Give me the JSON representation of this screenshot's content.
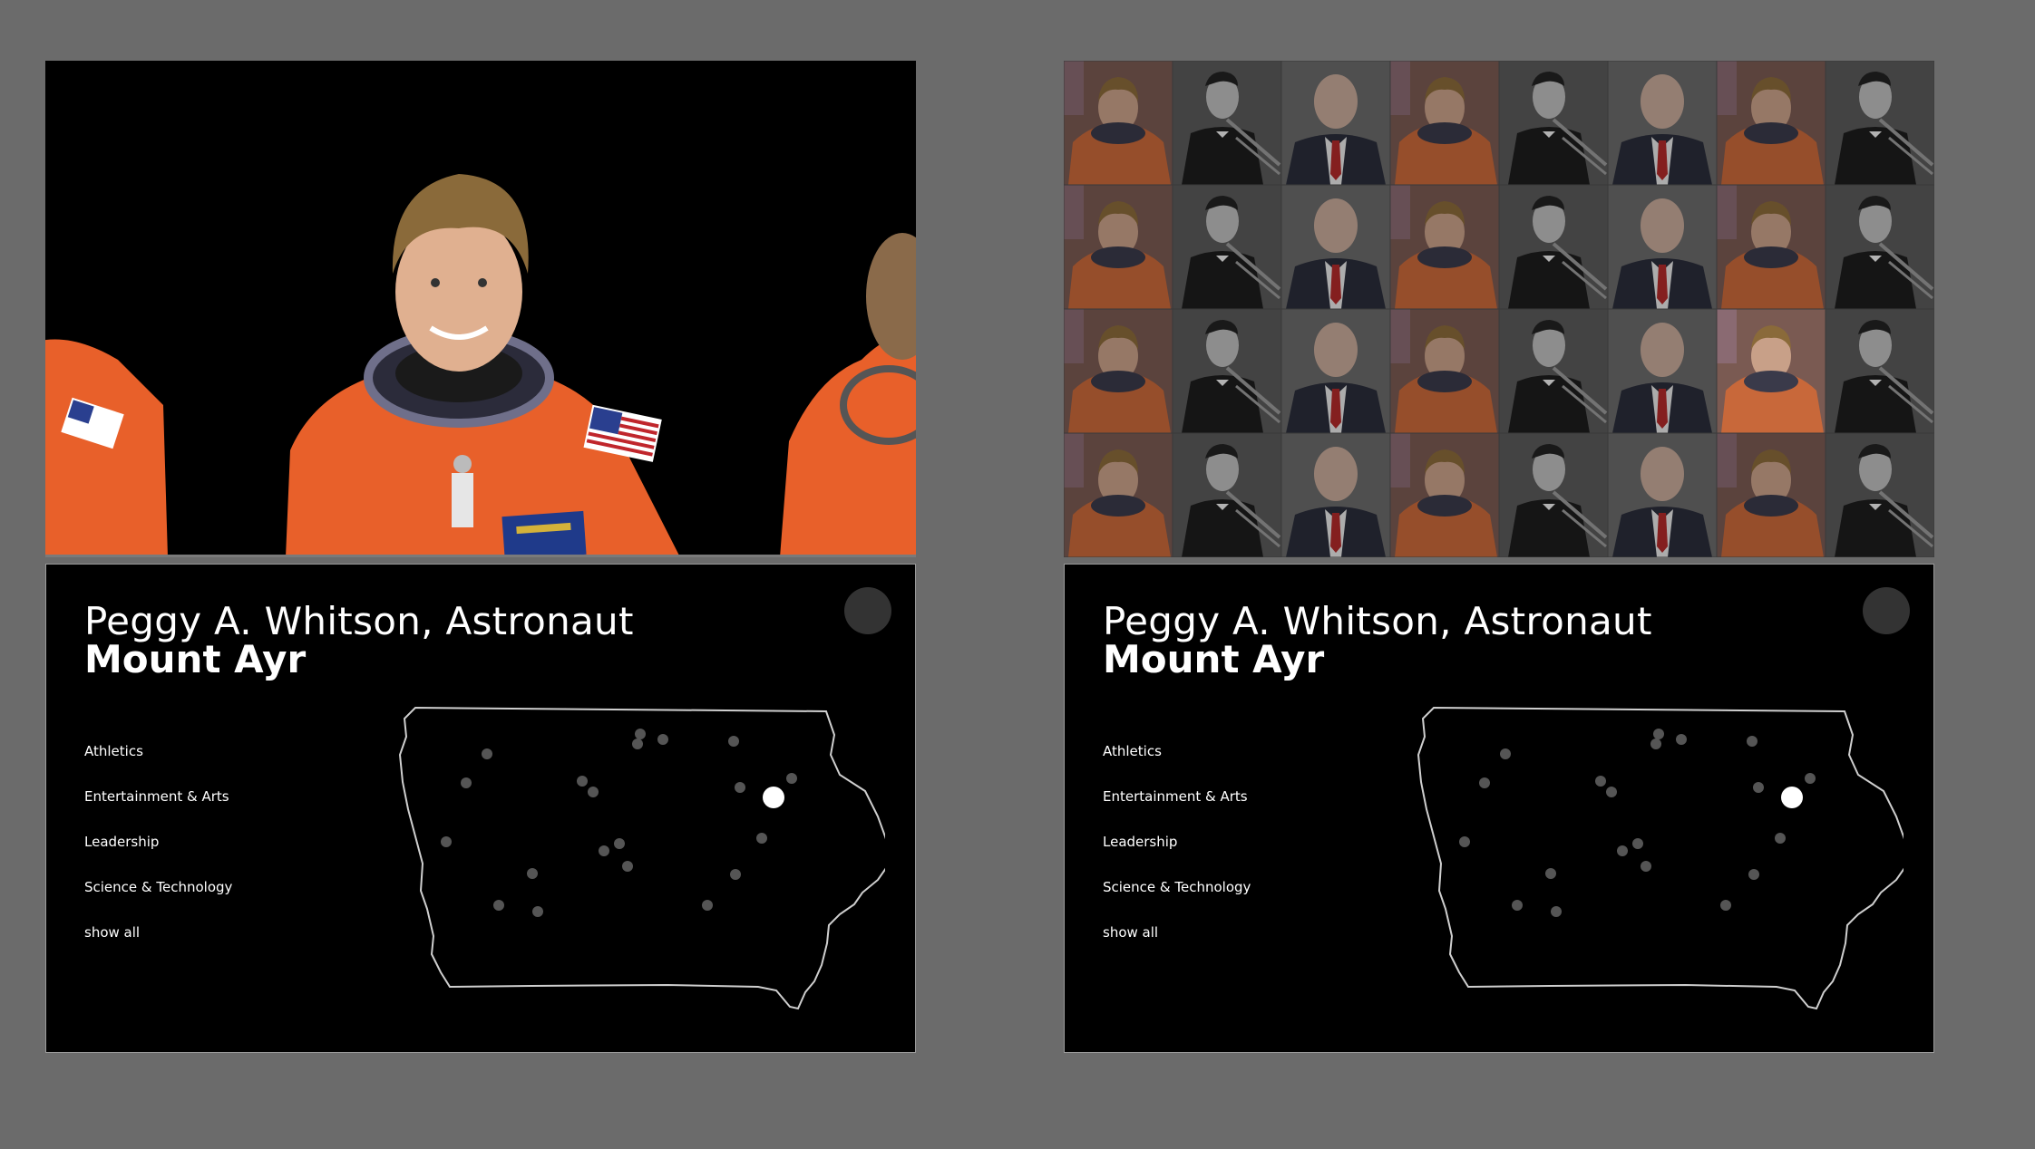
{
  "panels": [
    {
      "id": "left",
      "title": "Peggy A. Whitson, Astronaut",
      "location": "Mount Ayr",
      "categories": [
        "Athletics",
        "Entertainment & Arts",
        "Leadership",
        "Science & Technology",
        "show all"
      ]
    },
    {
      "id": "right",
      "title": "Peggy A. Whitson, Astronaut",
      "location": "Mount Ayr",
      "categories": [
        "Athletics",
        "Entertainment & Arts",
        "Leadership",
        "Science & Technology",
        "show all"
      ]
    }
  ],
  "colors": {
    "page_background": "#6b6b6b",
    "card_background": "#000000",
    "dot_inactive": "#555555",
    "dot_active": "#ffffff",
    "suit_orange": "#e8602a"
  },
  "icons": [
    "iowa-map",
    "location-dot",
    "astronaut-portrait",
    "trumpet-player-portrait",
    "elderly-man-portrait"
  ]
}
